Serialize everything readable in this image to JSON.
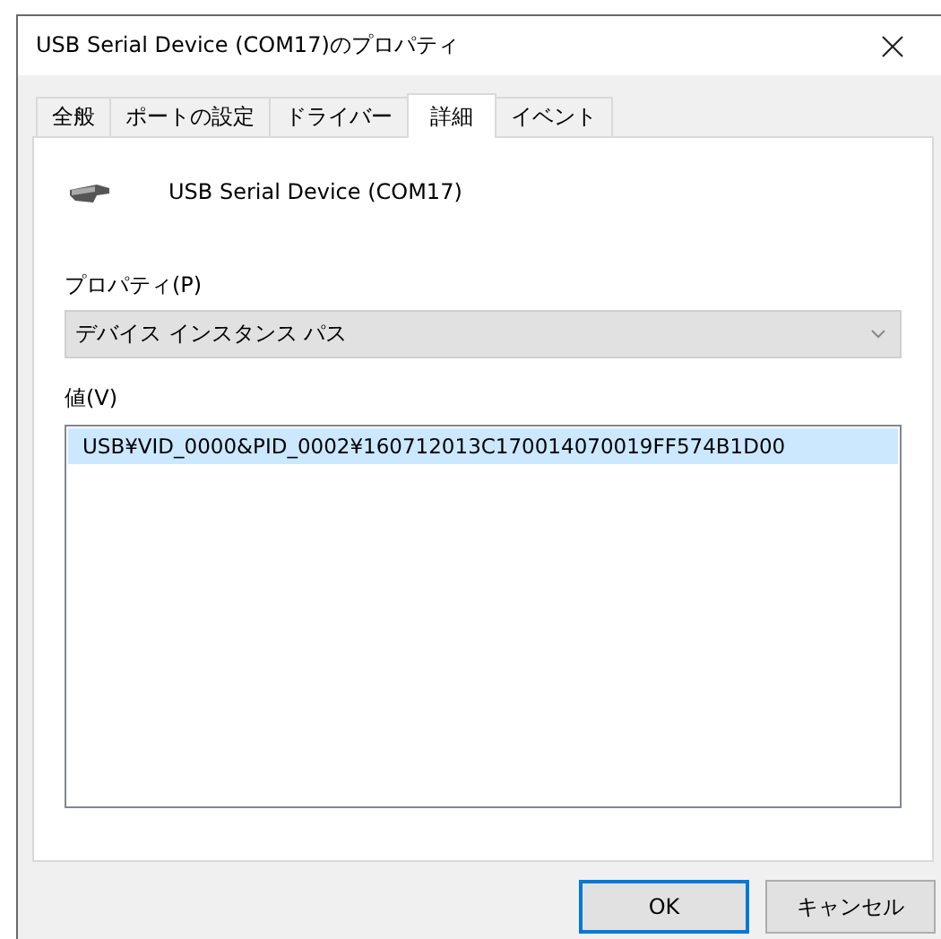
{
  "window": {
    "title": "USB Serial Device (COM17)のプロパティ"
  },
  "tabs": [
    {
      "label": "全般",
      "selected": false
    },
    {
      "label": "ポートの設定",
      "selected": false
    },
    {
      "label": "ドライバー",
      "selected": false
    },
    {
      "label": "詳細",
      "selected": true
    },
    {
      "label": "イベント",
      "selected": false
    }
  ],
  "device": {
    "name": "USB Serial Device (COM17)"
  },
  "property": {
    "label": "プロパティ(P)",
    "value": "デバイス インスタンス パス"
  },
  "values": {
    "label": "値(V)",
    "items": [
      {
        "text": "USB¥VID_0000&PID_0002¥160712013C170014070019FF574B1D00",
        "selected": true
      }
    ]
  },
  "buttons": [
    {
      "label": "OK",
      "default": true
    },
    {
      "label": "キャンセル",
      "default": false
    }
  ]
}
